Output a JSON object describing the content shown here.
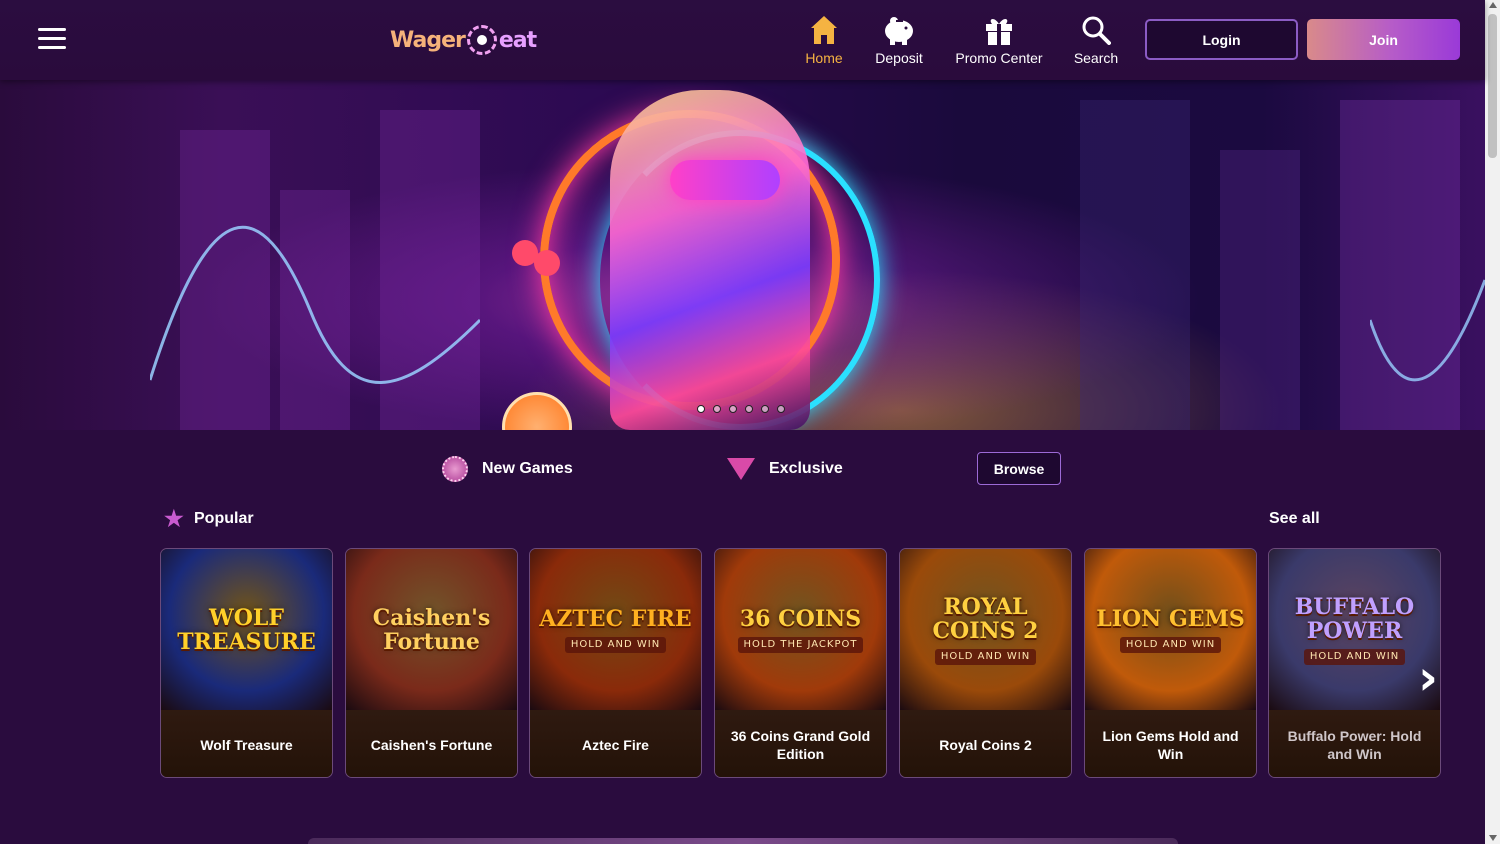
{
  "header": {
    "logo_text_1": "Wager",
    "logo_text_2": "eat",
    "nav": [
      {
        "label": "Home",
        "icon": "home-icon",
        "active": true
      },
      {
        "label": "Deposit",
        "icon": "piggy-bank-icon",
        "active": false
      },
      {
        "label": "Promo Center",
        "icon": "gift-icon",
        "active": false
      },
      {
        "label": "Search",
        "icon": "search-icon",
        "active": false
      }
    ],
    "login_label": "Login",
    "join_label": "Join"
  },
  "hero": {
    "slides_count": 6,
    "active_slide": 1
  },
  "filters": {
    "new_games": "New Games",
    "exclusive": "Exclusive",
    "browse": "Browse"
  },
  "section": {
    "title": "Popular",
    "see_all": "See all"
  },
  "games": [
    {
      "name": "Wolf Treasure",
      "art_title": "WOLF TREASURE",
      "art_sub": "",
      "bg": "#1a2a7a",
      "accent": "#ffd02a"
    },
    {
      "name": "Caishen's Fortune",
      "art_title": "Caishen's Fortune",
      "art_sub": "",
      "bg": "#7a2a1a",
      "accent": "#ffd060"
    },
    {
      "name": "Aztec Fire",
      "art_title": "AZTEC FIRE",
      "art_sub": "HOLD AND WIN",
      "bg": "#8a2a0a",
      "accent": "#ffb020"
    },
    {
      "name": "36 Coins Grand Gold Edition",
      "art_title": "36 COINS",
      "art_sub": "HOLD THE JACKPOT",
      "bg": "#a03a0a",
      "accent": "#ffd040"
    },
    {
      "name": "Royal Coins 2",
      "art_title": "ROYAL COINS 2",
      "art_sub": "HOLD AND WIN",
      "bg": "#9a4a0a",
      "accent": "#ffd040"
    },
    {
      "name": "Lion Gems Hold and Win",
      "art_title": "LION GEMS",
      "art_sub": "HOLD AND WIN",
      "bg": "#c05a0a",
      "accent": "#ffc030"
    },
    {
      "name": "Buffalo Power: Hold and Win",
      "art_title": "BUFFALO POWER",
      "art_sub": "HOLD AND WIN",
      "bg": "#3a3a6a",
      "accent": "#c0a0ff"
    }
  ],
  "colors": {
    "background": "#2a0c3e",
    "active_nav": "#f5b342",
    "join_gradient_start": "#d98a8a",
    "join_gradient_end": "#9a3ad8"
  }
}
